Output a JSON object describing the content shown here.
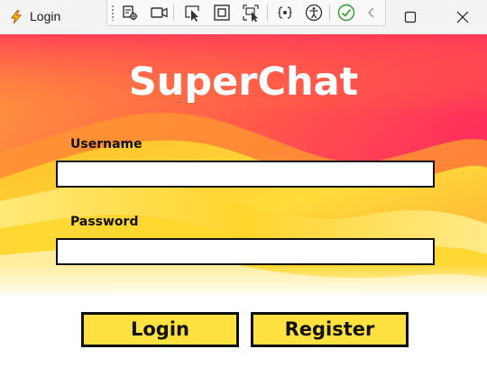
{
  "window": {
    "title": "Login",
    "icon": "lightning-app-icon"
  },
  "devtools": {
    "icons": [
      "live-visual-tree-icon",
      "record-icon",
      "select-element-icon",
      "display-layout-adorners-icon",
      "track-focus-icon",
      "binding-failures-icon",
      "accessibility-checker-icon",
      "check-icon",
      "collapse-chevron-icon"
    ]
  },
  "app": {
    "title": "SuperChat",
    "username_label": "Username",
    "username_value": "",
    "password_label": "Password",
    "password_value": "",
    "login_label": "Login",
    "register_label": "Register"
  },
  "colors": {
    "button_fill": "#ffe13f",
    "gradient_top": "#ff2d5c",
    "gradient_mid": "#ff8a2a",
    "wave_yellow": "#ffd22b"
  }
}
